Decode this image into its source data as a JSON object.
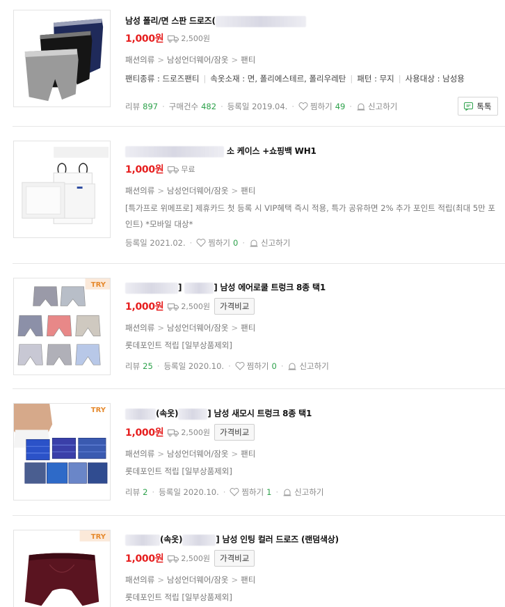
{
  "products": [
    {
      "title_prefix": "",
      "title": "남성 폴리/면 스판 드로즈(",
      "price": "1,000원",
      "shipping": "2,500원",
      "category": [
        "패션의류",
        "남성언더웨어/잠옷",
        "팬티"
      ],
      "specs": [
        "팬티종류 : 드로즈팬티",
        "속옷소재 : 면, 폴리에스테르, 폴리우레탄",
        "패턴 : 무지",
        "사용대상 : 남성용"
      ],
      "meta": {
        "review_label": "리뷰",
        "review_count": "897",
        "purchase_label": "구매건수",
        "purchase_count": "482",
        "date": "등록일 2019.04.",
        "wish_label": "찜하기",
        "wish_count": "49",
        "report_label": "신고하기"
      },
      "talk_label": "톡톡"
    },
    {
      "title": "소 케이스 +쇼핑백 WH1",
      "price": "1,000원",
      "shipping": "무료",
      "category": [
        "패션의류",
        "남성언더웨어/잠옷",
        "팬티"
      ],
      "desc": "[특가프로 위메프로] 제휴카드 첫 등록 시 VIP혜택 즉시 적용, 특가 공유하면 2% 추가 포인트 적립(최대 5만 포인트) *모바일 대상*",
      "meta": {
        "date": "등록일 2021.02.",
        "wish_label": "찜하기",
        "wish_count": "0",
        "report_label": "신고하기"
      }
    },
    {
      "title_a": "]",
      "title": "] 남성 에어로쿨 트렁크 8종 택1",
      "price": "1,000원",
      "shipping": "2,500원",
      "compare_label": "가격비교",
      "category": [
        "패션의류",
        "남성언더웨어/잠옷",
        "팬티"
      ],
      "desc": "롯데포인트 적립 [일부상품제외]",
      "meta": {
        "review_label": "리뷰",
        "review_count": "25",
        "date": "등록일 2020.10.",
        "wish_label": "찜하기",
        "wish_count": "0",
        "report_label": "신고하기"
      },
      "badge": "TRY"
    },
    {
      "title_a": "(속옷)",
      "title": "] 남성 새모시 트렁크 8종 택1",
      "price": "1,000원",
      "shipping": "2,500원",
      "compare_label": "가격비교",
      "category": [
        "패션의류",
        "남성언더웨어/잠옷",
        "팬티"
      ],
      "desc": "롯데포인트 적립 [일부상품제외]",
      "meta": {
        "review_label": "리뷰",
        "review_count": "2",
        "date": "등록일 2020.10.",
        "wish_label": "찜하기",
        "wish_count": "1",
        "report_label": "신고하기"
      },
      "badge": "TRY"
    },
    {
      "title_a": "(속옷)",
      "title": "] 남성 인팅 컬러 드로즈 (랜덤색상)",
      "price": "1,000원",
      "shipping": "2,500원",
      "compare_label": "가격비교",
      "category": [
        "패션의류",
        "남성언더웨어/잠옷",
        "팬티"
      ],
      "desc": "롯데포인트 적립 [일부상품제외]",
      "badge": "TRY"
    }
  ],
  "colors": {
    "price": "#e61e1e",
    "count": "#2ca14a",
    "badge": "#e68a2e"
  }
}
